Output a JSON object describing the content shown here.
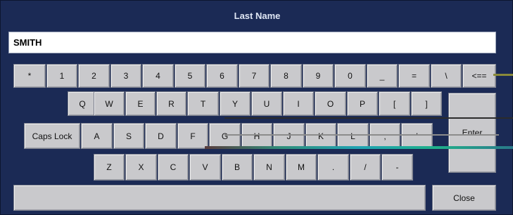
{
  "window": {
    "title": "Last Name"
  },
  "input": {
    "value": "SMITH"
  },
  "keyboard": {
    "row1": [
      "*",
      "1",
      "2",
      "3",
      "4",
      "5",
      "6",
      "7",
      "8",
      "9",
      "0",
      "_",
      "=",
      "\\",
      "<=="
    ],
    "row2": [
      "Q",
      "W",
      "E",
      "R",
      "T",
      "Y",
      "U",
      "I",
      "O",
      "P",
      "[",
      "]"
    ],
    "row3": [
      "Caps Lock",
      "A",
      "S",
      "D",
      "F",
      "G",
      "H",
      "J",
      "K",
      "L",
      ";",
      "'"
    ],
    "row4": [
      "Z",
      "X",
      "C",
      "V",
      "B",
      "N",
      "M",
      ".",
      "/",
      "-"
    ],
    "enter": "Enter",
    "close": "Close",
    "space": ""
  }
}
